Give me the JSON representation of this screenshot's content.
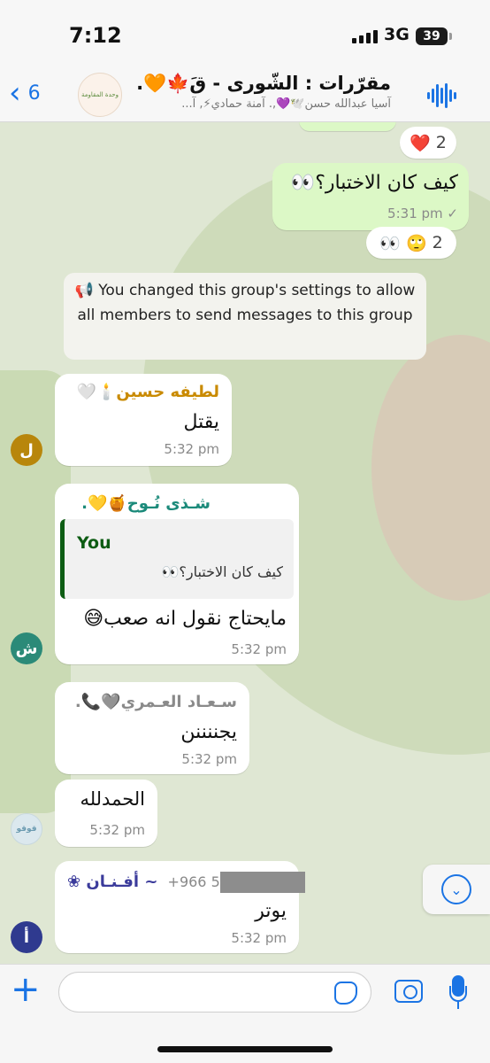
{
  "status_bar": {
    "time": "7:12",
    "network": "3G",
    "battery": "39"
  },
  "header": {
    "back_count": "6",
    "title": "مقرّرات : الشّورى - قَ🍁🧡.",
    "subtitle": "آسيا عبدالله حسن🕊️💜,. آمنة حمادي⚡, آ...",
    "avatar_text": "وحدة المقاومة"
  },
  "colors": {
    "accent": "#1b74e4",
    "outgoing_bubble": "#dcf8c6",
    "incoming_bubble": "#ffffff",
    "chat_bg": "#dfe7d3"
  },
  "messages": {
    "top_reaction": {
      "emoji": "❤️",
      "count": "2"
    },
    "out1": {
      "text": "كيف كان الاختبار؟👀",
      "time": "5:31 pm",
      "check": "✓"
    },
    "out1_reaction": {
      "emoji": "👀 🙄",
      "count": "2"
    },
    "system": "📢 You changed this group's settings to allow all members to send messages to this group",
    "m1": {
      "sender": "لطيفه حسين🕯️🤍",
      "sender_color": "#c98a00",
      "text": "يقتل",
      "time": "5:32 pm",
      "avatar": "ل",
      "avatar_color": "#b8860b"
    },
    "m2": {
      "sender": "شـذى نُـوح🍯💛.",
      "sender_color": "#1b8a7a",
      "reply_name": "You",
      "reply_text": "كيف كان الاختبار؟👀",
      "text": "مايحتاج نقول انه صعب😅",
      "time": "5:32 pm",
      "avatar": "ش",
      "avatar_color": "#2b8a78"
    },
    "m3": {
      "sender": "سـعـاد العـمري🩶📞.",
      "sender_color": "#8a8a8a",
      "text": "يجننننن",
      "time": "5:32 pm"
    },
    "m4": {
      "text": "الحمدلله",
      "time": "5:32 pm",
      "avatar": "قوقو"
    },
    "m5": {
      "sender": "~ أفـنـان ❀",
      "sender_color": "#3b3b9b",
      "phone": "+966 5",
      "text": "يوتر",
      "time": "5:32 pm",
      "avatar": "أ",
      "avatar_color": "#2f3a8f"
    }
  },
  "composer": {
    "placeholder": "",
    "value": ""
  },
  "icons": {
    "back": "chevron-left-icon",
    "audio": "audio-wave-icon",
    "scroll": "chevron-down-icon",
    "plus": "plus-icon",
    "sticker": "sticker-icon",
    "camera": "camera-icon",
    "mic": "microphone-icon"
  }
}
